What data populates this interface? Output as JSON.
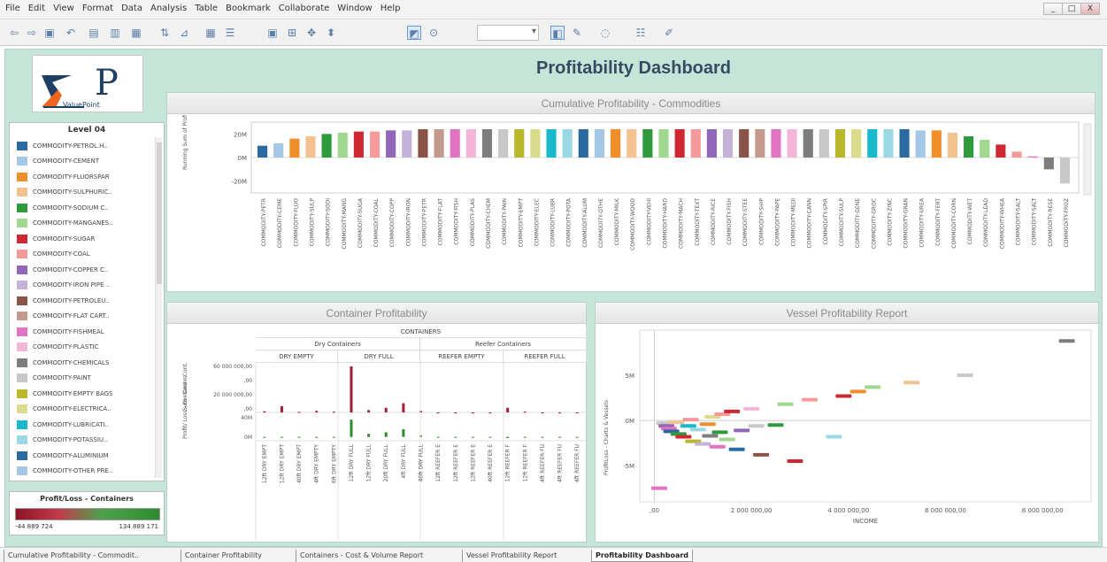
{
  "menu": [
    "File",
    "Edit",
    "View",
    "Format",
    "Data",
    "Analysis",
    "Table",
    "Bookmark",
    "Collaborate",
    "Window",
    "Help"
  ],
  "window_controls": [
    "_",
    "□",
    "X"
  ],
  "dashboard_title": "Profitability Dashboard",
  "logo": {
    "letter": "P",
    "text": "ValuePoint"
  },
  "legend": {
    "title": "Level 04",
    "items": [
      {
        "label": "COMMODITY-PETROL.H..",
        "color": "#2a6aa0"
      },
      {
        "label": "COMMODITY-CEMENT",
        "color": "#a5c7e6"
      },
      {
        "label": "COMMODITY-FLUORSPAR",
        "color": "#f08e2a"
      },
      {
        "label": "COMMODITY-SULPHURIC..",
        "color": "#f4c291"
      },
      {
        "label": "COMMODITY-SODIUM C..",
        "color": "#2f9a3c"
      },
      {
        "label": "COMMODITY-MANGANES..",
        "color": "#9fd88e"
      },
      {
        "label": "COMMODITY-SUGAR",
        "color": "#d02832"
      },
      {
        "label": "COMMODITY-COAL",
        "color": "#f59a9a"
      },
      {
        "label": "COMMODITY-COPPER C..",
        "color": "#9266b8"
      },
      {
        "label": "COMMODITY-IRON PIPE ..",
        "color": "#c5b2d8"
      },
      {
        "label": "COMMODITY-PETROLEU..",
        "color": "#8a5348"
      },
      {
        "label": "COMMODITY-FLAT CART..",
        "color": "#c49a8f"
      },
      {
        "label": "COMMODITY-FISHMEAL",
        "color": "#e173c2"
      },
      {
        "label": "COMMODITY-PLASTIC",
        "color": "#f4b6d8"
      },
      {
        "label": "COMMODITY-CHEMICALS",
        "color": "#7d7d7d"
      },
      {
        "label": "COMMODITY-PAINT",
        "color": "#c8c8c8"
      },
      {
        "label": "COMMODITY-EMPTY BAGS",
        "color": "#b8b82a"
      },
      {
        "label": "COMMODITY-ELECTRICA..",
        "color": "#dbdb8d"
      },
      {
        "label": "COMMODITY-LUBRICATI..",
        "color": "#1ab8cc"
      },
      {
        "label": "COMMODITY-POTASSIU..",
        "color": "#9ad9e4"
      },
      {
        "label": "COMMODITY-ALUMINIUM",
        "color": "#2a6aa0"
      },
      {
        "label": "COMMODITY-OTHER PRE..",
        "color": "#a5c7e6"
      }
    ]
  },
  "profit_loss": {
    "title": "Profit/Loss - Containers",
    "min": "-44 889 724",
    "max": "134 889 171"
  },
  "cumulative_chart": {
    "title": "Cumulative Profitability - Commodities"
  },
  "container_chart": {
    "title": "Container Profitability",
    "header": "CONTAINERS",
    "groups": [
      "Dry Containers",
      "Reefer Containers"
    ],
    "subgroups": [
      "DRY EMPTY",
      "DRY FULL",
      "REEFER EMPTY",
      "REEFER FULL"
    ],
    "row_labels": [
      "Sum - Cost - Cont.",
      "Profit/ Loss - Conta iners"
    ]
  },
  "vessel_chart": {
    "title": "Vessel Profitability Report"
  },
  "tabs": [
    "Cumulative Profitability - Commodit..",
    "Container Profitability",
    "Containers - Cost & Volume Report",
    "Vessel Profitability Report",
    "Profitability Dashboard"
  ],
  "chart_data": [
    {
      "type": "bar",
      "title": "Cumulative Profitability - Commodities",
      "ylabel": "Running Sum of ProfitLoss - Commodities",
      "ylim": [
        -30,
        30
      ],
      "yticks": [
        "20M",
        "0M",
        "-20M"
      ],
      "categories": [
        "COMMODITY-PETR",
        "COMMODITY-CEME",
        "COMMODITY-FLUO",
        "COMMODITY-SULP",
        "COMMODITY-SODI",
        "COMMODITY-MANG",
        "COMMODITY-SUGA",
        "COMMODITY-COAL",
        "COMMODITY-COPP",
        "COMMODITY-IRON",
        "COMMODITY-PETR",
        "COMMODITY-FLAT",
        "COMMODITY-FISH",
        "COMMODITY-PLAS",
        "COMMODITY-CHEM",
        "COMMODITY-PAIN",
        "COMMODITY-EMPT",
        "COMMODITY-ELEC",
        "COMMODITY-LUBR",
        "COMMODITY-POTA",
        "COMMODITY-ALUM",
        "COMMODITY-OTHE",
        "COMMODITY-MILK",
        "COMMODITY-WOOD",
        "COMMODITY-VEHI",
        "COMMODITY-HARD",
        "COMMODITY-MACH",
        "COMMODITY-TEXT",
        "COMMODITY-RICE",
        "COMMODITY-FISH",
        "COMMODITY-STEE",
        "COMMODITY-SHIP",
        "COMMODITY-PAPE",
        "COMMODITY-MEDI",
        "COMMODITY-CANN",
        "COMMODITY-SPIR",
        "COMMODITY-SULP",
        "COMMODITY-GENE",
        "COMMODITY-GROC",
        "COMMODITY-ZINC",
        "COMMODITY-GRAN",
        "COMMODITY-UREA",
        "COMMODITY-FERT",
        "COMMODITY-CORN",
        "COMMODITY-WET",
        "COMMODITY-LEAD",
        "COMMODITY-WHEA",
        "COMMODITY-SALT",
        "COMMODITY-SALT",
        "COMMODITY-RESE",
        "COMMODITY-FROZ"
      ],
      "values": [
        10,
        12,
        16,
        18,
        20,
        21,
        22,
        22,
        23,
        23,
        24,
        24,
        24,
        24,
        24,
        24,
        24,
        24,
        24,
        24,
        24,
        24,
        24,
        24,
        24,
        24,
        24,
        24,
        24,
        24,
        24,
        24,
        24,
        24,
        24,
        24,
        24,
        24,
        24,
        24,
        24,
        23,
        23,
        21,
        18,
        15,
        11,
        5,
        1,
        -10,
        -22
      ],
      "colors": [
        "#2a6aa0",
        "#a5c7e6",
        "#f08e2a",
        "#f4c291",
        "#2f9a3c",
        "#9fd88e",
        "#d02832",
        "#f59a9a",
        "#9266b8",
        "#c5b2d8",
        "#8a5348",
        "#c49a8f",
        "#e173c2",
        "#f4b6d8",
        "#7d7d7d",
        "#c8c8c8",
        "#b8b82a",
        "#dbdb8d",
        "#1ab8cc",
        "#9ad9e4",
        "#2a6aa0",
        "#a5c7e6",
        "#f08e2a",
        "#f4c291",
        "#2f9a3c",
        "#9fd88e",
        "#d02832",
        "#f59a9a",
        "#9266b8",
        "#c5b2d8",
        "#8a5348",
        "#c49a8f",
        "#e173c2",
        "#f4b6d8",
        "#7d7d7d",
        "#c8c8c8",
        "#b8b82a",
        "#dbdb8d",
        "#1ab8cc",
        "#9ad9e4",
        "#2a6aa0",
        "#a5c7e6",
        "#f08e2a",
        "#f4c291",
        "#2f9a3c",
        "#9fd88e",
        "#d02832",
        "#f59a9a",
        "#e173c2",
        "#7d7d7d",
        "#c8c8c8"
      ]
    },
    {
      "type": "bar",
      "title": "Container Profitability",
      "categories": [
        "12ft DRY EMPT",
        "12ft DRY EMPT",
        "40ft DRY EMPT",
        "4ft DRY EMPTY",
        "6ft DRY EMPTY",
        "12ft DRY FULL",
        "12ft DRY FULL",
        "20ft DRY FULL",
        "4ft DRY FULL",
        "40ft DRY FULL",
        "12ft REEFER E",
        "12ft REEFER E",
        "12ft REEFER E",
        "40ft REEFER E",
        "12ft REEFER F",
        "12ft REEFER F",
        "4ft REEFER FU",
        "4ft REEFER FU",
        "4ft REEFER FU"
      ],
      "group_of_category": [
        "DRY EMPTY",
        "DRY EMPTY",
        "DRY EMPTY",
        "DRY EMPTY",
        "DRY EMPTY",
        "DRY FULL",
        "DRY FULL",
        "DRY FULL",
        "DRY FULL",
        "DRY FULL",
        "REEFER EMPTY",
        "REEFER EMPTY",
        "REEFER EMPTY",
        "REEFER EMPTY",
        "REEFER FULL",
        "REEFER FULL",
        "REEFER FULL",
        "REEFER FULL",
        "REEFER FULL"
      ],
      "series": [
        {
          "name": "Sum - Cost - Cont.",
          "yticks": [
            "60 000 000,00",
            ",00",
            "20 000 000,00",
            ",00"
          ],
          "ylim": [
            0,
            60000000
          ],
          "values": [
            1500000,
            8000000,
            500000,
            2000000,
            1000000,
            60000000,
            3000000,
            6000000,
            12000000,
            2000000,
            0,
            0,
            0,
            0,
            6000000,
            1000000,
            0,
            0,
            0
          ],
          "color": "#a31e35"
        },
        {
          "name": "Profit/ Loss - Containers",
          "yticks": [
            "40M",
            "0M"
          ],
          "ylim": [
            -10,
            50
          ],
          "values": [
            -1,
            -2,
            0,
            -1,
            0,
            45,
            8,
            12,
            20,
            4,
            0,
            0,
            0,
            0,
            -3,
            0,
            0,
            0,
            0
          ],
          "color": "#2e8b2e"
        }
      ]
    },
    {
      "type": "scatter",
      "title": "Vessel Profitability Report",
      "xlabel": "INCOME",
      "ylabel": "ProfitLoss - Charts & Vessels",
      "xticks": [
        ",00",
        "2 000 000,00",
        "4 000 000,00",
        "6 000 000,00",
        "8 000 000,00"
      ],
      "yticks": [
        "5M",
        "0M",
        "-5M"
      ],
      "xlim": [
        -300000,
        9000000
      ],
      "ylim": [
        -9000000,
        10000000
      ],
      "points": [
        {
          "x": 200000,
          "y": -300000,
          "color": "#c8c8c8"
        },
        {
          "x": 250000,
          "y": -600000,
          "color": "#9266b8"
        },
        {
          "x": 300000,
          "y": -900000,
          "color": "#e173c2"
        },
        {
          "x": 350000,
          "y": -1200000,
          "color": "#2a6aa0"
        },
        {
          "x": 450000,
          "y": -200000,
          "color": "#f4c291"
        },
        {
          "x": 500000,
          "y": -1500000,
          "color": "#2f9a3c"
        },
        {
          "x": 600000,
          "y": -1800000,
          "color": "#d02832"
        },
        {
          "x": 700000,
          "y": -600000,
          "color": "#1ab8cc"
        },
        {
          "x": 750000,
          "y": 100000,
          "color": "#f59a9a"
        },
        {
          "x": 800000,
          "y": -2300000,
          "color": "#b8b82a"
        },
        {
          "x": 900000,
          "y": -1000000,
          "color": "#9ad9e4"
        },
        {
          "x": 1000000,
          "y": -2600000,
          "color": "#c5b2d8"
        },
        {
          "x": 1100000,
          "y": -400000,
          "color": "#f08e2a"
        },
        {
          "x": 1150000,
          "y": -1700000,
          "color": "#7d7d7d"
        },
        {
          "x": 1200000,
          "y": 400000,
          "color": "#dbdb8d"
        },
        {
          "x": 1300000,
          "y": -2900000,
          "color": "#e173c2"
        },
        {
          "x": 1350000,
          "y": -1300000,
          "color": "#2f9a3c"
        },
        {
          "x": 1400000,
          "y": 700000,
          "color": "#f59a9a"
        },
        {
          "x": 1500000,
          "y": -2100000,
          "color": "#9fd88e"
        },
        {
          "x": 1600000,
          "y": 1000000,
          "color": "#d02832"
        },
        {
          "x": 1700000,
          "y": -3200000,
          "color": "#2a6aa0"
        },
        {
          "x": 1800000,
          "y": -1100000,
          "color": "#9266b8"
        },
        {
          "x": 2000000,
          "y": 1300000,
          "color": "#f4b6d8"
        },
        {
          "x": 2100000,
          "y": -600000,
          "color": "#c8c8c8"
        },
        {
          "x": 2200000,
          "y": -3800000,
          "color": "#8a5348"
        },
        {
          "x": 2500000,
          "y": -500000,
          "color": "#2f9a3c"
        },
        {
          "x": 2700000,
          "y": 1800000,
          "color": "#9fd88e"
        },
        {
          "x": 2900000,
          "y": -4500000,
          "color": "#d02832"
        },
        {
          "x": 3200000,
          "y": 2300000,
          "color": "#f59a9a"
        },
        {
          "x": 3700000,
          "y": -1800000,
          "color": "#9ad9e4"
        },
        {
          "x": 3900000,
          "y": 2700000,
          "color": "#d02832"
        },
        {
          "x": 4200000,
          "y": 3200000,
          "color": "#f08e2a"
        },
        {
          "x": 4500000,
          "y": 3700000,
          "color": "#9fd88e"
        },
        {
          "x": 5300000,
          "y": 4200000,
          "color": "#f4c291"
        },
        {
          "x": 6400000,
          "y": 5000000,
          "color": "#c8c8c8"
        },
        {
          "x": 8500000,
          "y": 8800000,
          "color": "#7d7d7d"
        },
        {
          "x": 100000,
          "y": -7500000,
          "color": "#e173c2"
        }
      ]
    }
  ]
}
